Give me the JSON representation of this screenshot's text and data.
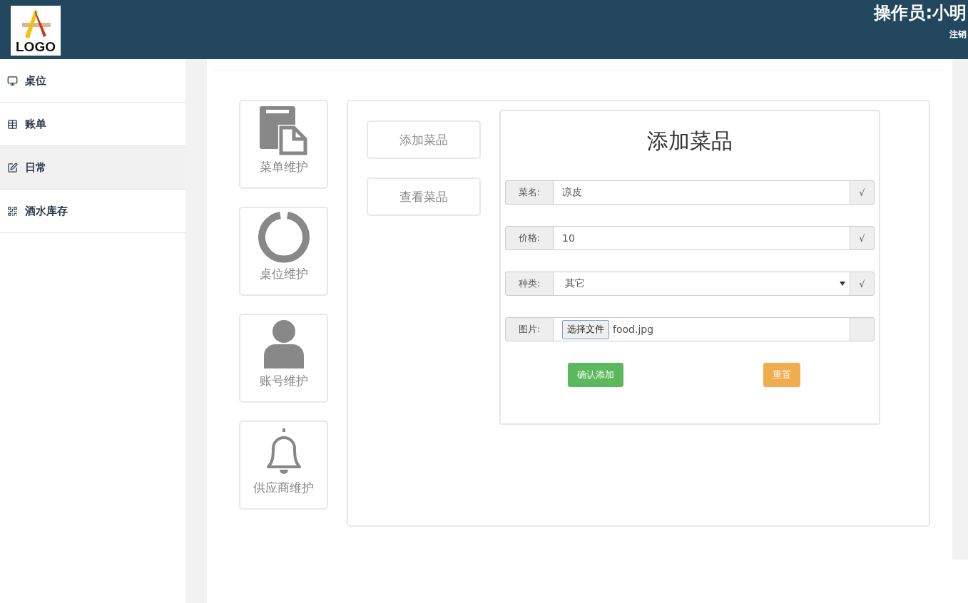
{
  "header": {
    "logo": {
      "text": "LOGO"
    },
    "operator": "操作员:小明",
    "logout": "注销"
  },
  "sidebar": {
    "items": [
      {
        "label": "桌位",
        "selected": false
      },
      {
        "label": "账单",
        "selected": false
      },
      {
        "label": "日常",
        "selected": true
      },
      {
        "label": "酒水库存",
        "selected": false
      }
    ]
  },
  "tiles": [
    {
      "label": "菜单维护"
    },
    {
      "label": "桌位维护"
    },
    {
      "label": "账号维护"
    },
    {
      "label": "供应商维护"
    }
  ],
  "submenu": [
    "添加菜品",
    "查看菜品"
  ],
  "form": {
    "title": "添加菜品",
    "rows": [
      {
        "kind": "text",
        "label": "菜名:",
        "value": "凉皮",
        "check": "√"
      },
      {
        "kind": "text",
        "label": "价格:",
        "value": "10",
        "check": "√"
      },
      {
        "kind": "select",
        "label": "种类:",
        "value": "其它",
        "check": "√"
      },
      {
        "kind": "file",
        "label": "图片:",
        "button": "选择文件",
        "value": "food.jpg"
      }
    ],
    "buttons": [
      {
        "kind": "success",
        "label": "确认添加"
      },
      {
        "kind": "warning",
        "label": "重置"
      }
    ]
  }
}
